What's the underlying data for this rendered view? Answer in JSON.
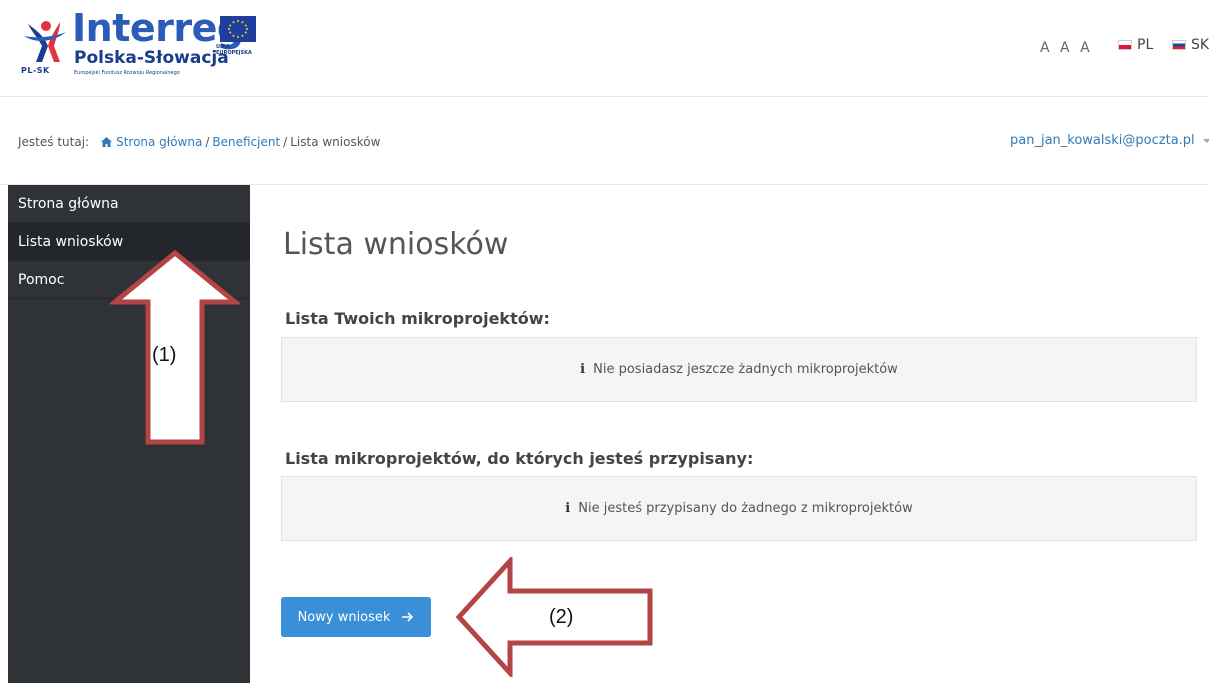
{
  "header": {
    "logo": {
      "brand": "Interreg",
      "region": "Polska-Słowacja",
      "fund": "Europejski Fundusz Rozwoju Regionalnego",
      "pl_sk": "PL-SK",
      "eu_caption": "UNIA EUROPEJSKA"
    },
    "font_size_controls": [
      "A",
      "A",
      "A"
    ],
    "languages": [
      {
        "code": "PL",
        "flag": "flag-pl-icon"
      },
      {
        "code": "SK",
        "flag": "flag-sk-icon"
      }
    ]
  },
  "breadcrumb": {
    "prefix": "Jesteś tutaj:",
    "items": [
      "Strona główna",
      "Beneficjent",
      "Lista wniosków"
    ],
    "separator": "/"
  },
  "user": {
    "email": "pan_jan_kowalski@poczta.pl"
  },
  "sidebar": {
    "items": [
      {
        "label": "Strona główna",
        "active": false
      },
      {
        "label": "Lista wniosków",
        "active": true
      },
      {
        "label": "Pomoc",
        "active": false
      }
    ]
  },
  "main": {
    "title": "Lista wniosków",
    "sections": [
      {
        "title": "Lista Twoich mikroprojektów:",
        "empty_message": "Nie posiadasz jeszcze żadnych mikroprojektów"
      },
      {
        "title": "Lista mikroprojektów, do których jesteś przypisany:",
        "empty_message": "Nie jesteś przypisany do żadnego z mikroprojektów"
      }
    ],
    "new_button": {
      "label": "Nowy wniosek",
      "icon": "arrow-right-icon"
    }
  },
  "annotations": [
    {
      "label": "(1)",
      "direction": "up"
    },
    {
      "label": "(2)",
      "direction": "left"
    }
  ],
  "colors": {
    "accent": "#3a8fd9",
    "link": "#337ab7",
    "sidebar": "#2f3338",
    "annotation_arrow": "#b34545"
  }
}
